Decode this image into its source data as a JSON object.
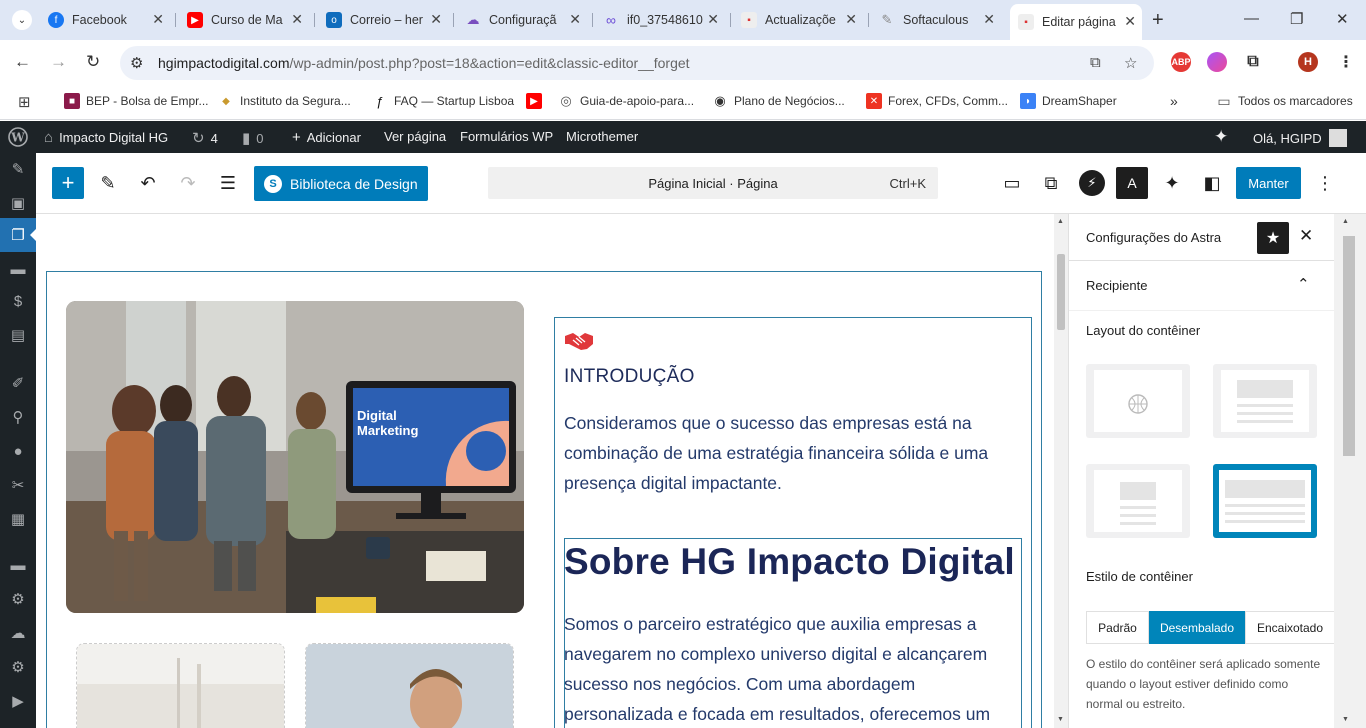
{
  "browser": {
    "tabs": [
      {
        "title": "Facebook",
        "icon": "facebook-icon",
        "color": "#1877f2"
      },
      {
        "title": "Curso de Ma",
        "icon": "youtube-icon",
        "color": "#ff0000"
      },
      {
        "title": "Correio – her",
        "icon": "outlook-icon",
        "color": "#0f6cbd"
      },
      {
        "title": "Configuraçã",
        "icon": "cloud-icon",
        "color": "#7a4fbf"
      },
      {
        "title": "if0_37548610",
        "icon": "infinity-icon",
        "color": "#6b4cd6"
      },
      {
        "title": "Actualizaçõe",
        "icon": "site-icon",
        "color": "#d33"
      },
      {
        "title": "Softaculous",
        "icon": "softaculous-icon",
        "color": "#888"
      },
      {
        "title": "Editar página",
        "icon": "softaculous-icon",
        "color": "#d33",
        "active": true
      }
    ],
    "url_host": "hgimpactodigital.com",
    "url_path": "/wp-admin/post.php?post=18&action=edit&classic-editor__forget",
    "profile_initial": "H",
    "bookmarks": [
      {
        "label": "BEP - Bolsa de Empr...",
        "icon": "bookmark-icon",
        "color": "#8b1a4a"
      },
      {
        "label": "Instituto da Segura...",
        "icon": "bookmark-icon",
        "color": "#c99a2e"
      },
      {
        "label": "FAQ — Startup Lisboa",
        "icon": "bookmark-icon",
        "color": "#111"
      },
      {
        "label": "",
        "icon": "youtube-icon",
        "color": "#ff0000"
      },
      {
        "label": "Guia-de-apoio-para...",
        "icon": "globe-icon",
        "color": "#555"
      },
      {
        "label": "Plano de Negócios...",
        "icon": "globe-icon",
        "color": "#333"
      },
      {
        "label": "Forex, CFDs, Comm...",
        "icon": "bookmark-icon",
        "color": "#e32"
      },
      {
        "label": "DreamShaper",
        "icon": "bookmark-icon",
        "color": "#3b82f6"
      }
    ],
    "all_bookmarks": "Todos os marcadores"
  },
  "adminbar": {
    "site_name": "Impacto Digital HG",
    "updates": "4",
    "comments": "0",
    "new": "Adicionar",
    "view": "Ver página",
    "forms": "Formulários WP",
    "microthemer": "Microthemer",
    "greeting": "Olá, HGIPD"
  },
  "toolbar": {
    "design_library": "Biblioteca de Design",
    "document_title": "Página Inicial · Página",
    "shortcut": "Ctrl+K",
    "save": "Manter"
  },
  "content": {
    "intro_title": "INTRODUÇÃO",
    "intro_body": "Consideramos que o sucesso das empresas está na combinação de uma estratégia financeira sólida e uma presença digital impactante.",
    "about_title": "Sobre HG Impacto Digital",
    "about_body": "Somos o parceiro estratégico que auxilia empresas a navegarem no complexo universo digital e alcançarem sucesso nos negócios. Com uma abordagem personalizada e focada em resultados, oferecemos um",
    "monitor_text_1": "Digital",
    "monitor_text_2": "Marketing"
  },
  "panel": {
    "title": "Configurações do Astra",
    "section": "Recipiente",
    "layout_label": "Layout do contêiner",
    "style_label": "Estilo de contêiner",
    "style_options": [
      "Padrão",
      "Desembalado",
      "Encaixotado"
    ],
    "style_selected": "Desembalado",
    "help": "O estilo do contêiner será aplicado somente quando o layout estiver definido como normal ou estreito."
  }
}
